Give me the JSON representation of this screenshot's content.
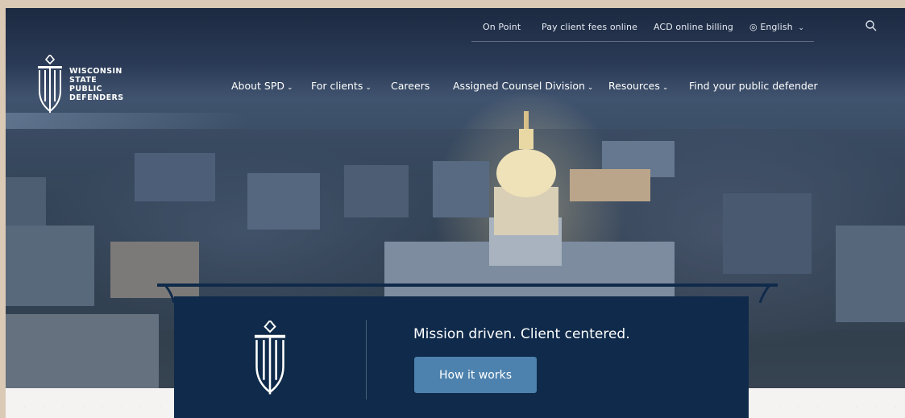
{
  "utility_nav": {
    "on_point": "On Point",
    "pay_fees": "Pay client fees online",
    "acd_billing": "ACD online billing",
    "language": "English"
  },
  "logo": {
    "line1": "WISCONSIN",
    "line2": "STATE",
    "line3": "PUBLIC",
    "line4": "DEFENDERS"
  },
  "main_nav": {
    "about": "About SPD",
    "for_clients": "For clients",
    "careers": "Careers",
    "acd": "Assigned Counsel Division",
    "resources": "Resources",
    "find": "Find your public defender"
  },
  "hero": {
    "tagline": "Mission driven. Client centered.",
    "cta": "How it works"
  },
  "icons": {
    "search": "search-icon",
    "globe": "globe-icon",
    "chevron": "chevron-down-icon",
    "logo": "sword-shield-logo"
  },
  "colors": {
    "panel": "#0f2a4a",
    "button": "#4e82ae"
  }
}
